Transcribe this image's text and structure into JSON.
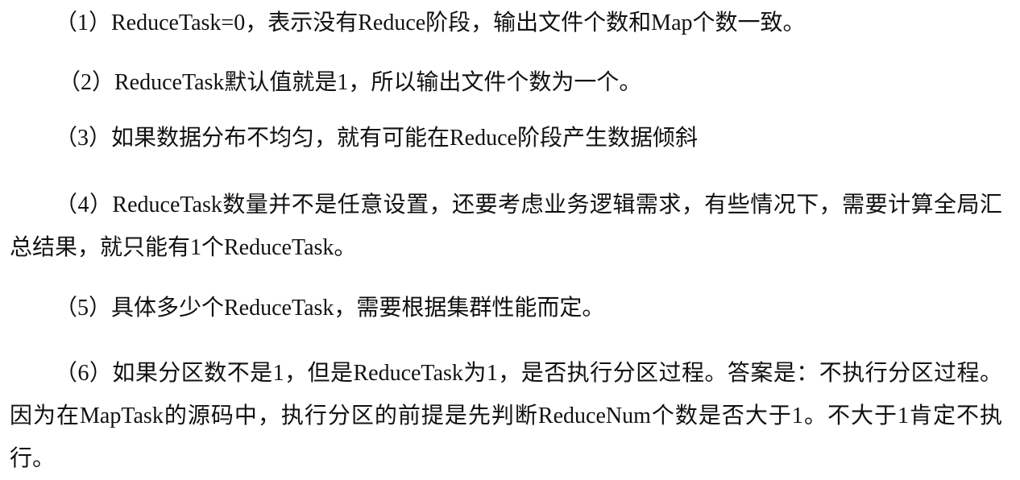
{
  "document": {
    "paragraphs": [
      "（1）ReduceTask=0，表示没有Reduce阶段，输出文件个数和Map个数一致。",
      "（2）ReduceTask默认值就是1，所以输出文件个数为一个。",
      "（3）如果数据分布不均匀，就有可能在Reduce阶段产生数据倾斜",
      "（4）ReduceTask数量并不是任意设置，还要考虑业务逻辑需求，有些情况下，需要计算全局汇总结果，就只能有1个ReduceTask。",
      "（5）具体多少个ReduceTask，需要根据集群性能而定。",
      "（6）如果分区数不是1，但是ReduceTask为1，是否执行分区过程。答案是：不执行分区过程。因为在MapTask的源码中，执行分区的前提是先判断ReduceNum个数是否大于1。不大于1肯定不执行。"
    ]
  }
}
